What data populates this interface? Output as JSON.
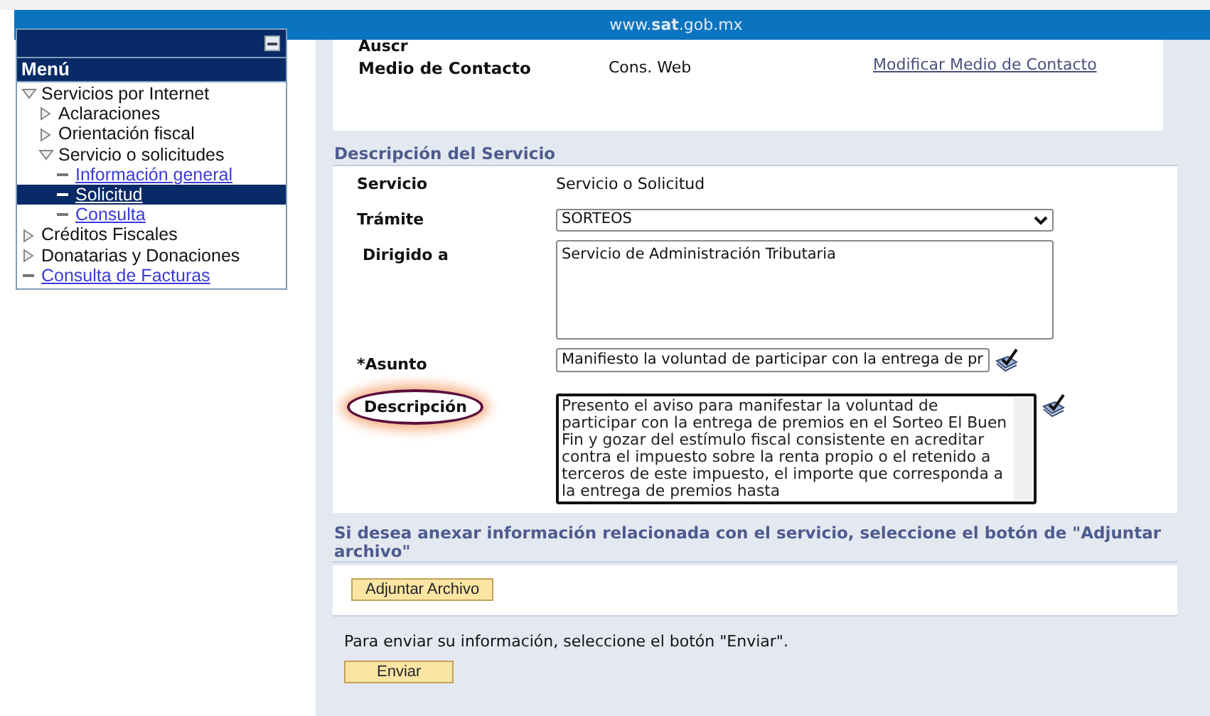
{
  "top_bar": {
    "site": "www.**sat**.gob.mx"
  },
  "sidebar": {
    "title": "Menú",
    "tree": [
      {
        "label": "Servicios por Internet",
        "kind": "folder",
        "expanded": true,
        "selected": false,
        "children": [
          {
            "label": "Aclaraciones",
            "kind": "folder",
            "expanded": false,
            "selected": false
          },
          {
            "label": "Orientación fiscal",
            "kind": "folder",
            "expanded": false,
            "selected": false
          },
          {
            "label": "Servicio o solicitudes",
            "kind": "folder",
            "expanded": true,
            "selected": false,
            "children": [
              {
                "label": "Información general",
                "kind": "link",
                "selected": false
              },
              {
                "label": "Solicitud",
                "kind": "link",
                "selected": true
              },
              {
                "label": "Consulta",
                "kind": "link",
                "selected": false
              }
            ]
          }
        ]
      },
      {
        "label": "Créditos Fiscales",
        "kind": "folder",
        "expanded": false,
        "selected": false
      },
      {
        "label": "Donatarias y Donaciones",
        "kind": "folder",
        "expanded": false,
        "selected": false
      },
      {
        "label": "Consulta de Facturas",
        "kind": "link",
        "selected": false
      }
    ]
  },
  "contact": {
    "cut_label": "Auscr",
    "label": "Medio de Contacto",
    "value": "Cons. Web",
    "link": "Modificar Medio de Contacto"
  },
  "service": {
    "title": "Descripción del Servicio",
    "fields": [
      {
        "kind": "text",
        "label": "Servicio",
        "value": "Servicio o Solicitud"
      },
      {
        "kind": "select",
        "label": "Trámite",
        "value": "SORTEOS"
      },
      {
        "kind": "textarea",
        "label": "Dirigido a",
        "value": "Servicio de Administración Tributaria",
        "scrollable": false,
        "highlighted": false,
        "tool_icon": false
      },
      {
        "kind": "input",
        "label": "*Asunto",
        "value": "Manifiesto la voluntad de participar con la entrega de pr",
        "highlighted": false,
        "tool_icon": true
      },
      {
        "kind": "textarea",
        "label": "Descripción",
        "value": "Presento el aviso para manifestar la voluntad de participar con la entrega de premios en el Sorteo El Buen Fin y gozar del estímulo fiscal consistente en acreditar contra el impuesto sobre la renta propio o el retenido a terceros de este impuesto, el importe que corresponda a la entrega de premios hasta",
        "scrollable": true,
        "highlighted": true,
        "tool_icon": true
      }
    ]
  },
  "attach": {
    "title": "Si desea anexar información relacionada con el servicio, seleccione el botón de \"Adjuntar archivo\"",
    "button": "Adjuntar Archivo"
  },
  "send": {
    "text": "Para enviar su información, seleccione el botón \"Enviar\".",
    "button": "Enviar"
  }
}
